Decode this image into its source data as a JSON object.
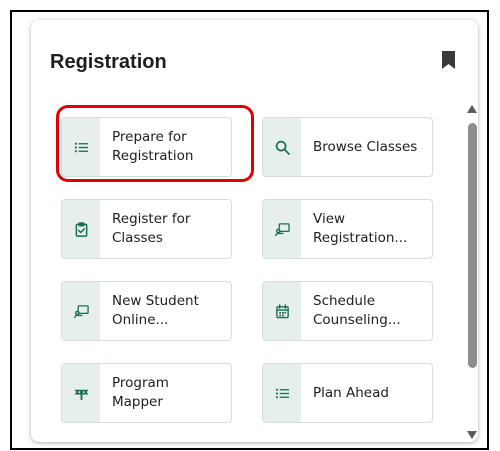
{
  "card": {
    "title": "Registration",
    "bookmark_icon": "bookmark-icon"
  },
  "colors": {
    "icon_green": "#1b6e53",
    "icon_bg": "#e6efeb",
    "highlight": "#e00000"
  },
  "tiles": [
    {
      "label": "Prepare for\nRegistration",
      "icon": "list-icon"
    },
    {
      "label": "Browse Classes",
      "icon": "search-icon"
    },
    {
      "label": "Register for\nClasses",
      "icon": "clipboard-check-icon"
    },
    {
      "label": "View\nRegistration...",
      "icon": "presentation-icon"
    },
    {
      "label": "New Student\nOnline...",
      "icon": "presentation-icon"
    },
    {
      "label": "Schedule\nCounseling...",
      "icon": "calendar-icon"
    },
    {
      "label": "Program\nMapper",
      "icon": "map-signpost-icon"
    },
    {
      "label": "Plan Ahead",
      "icon": "list-icon"
    }
  ]
}
